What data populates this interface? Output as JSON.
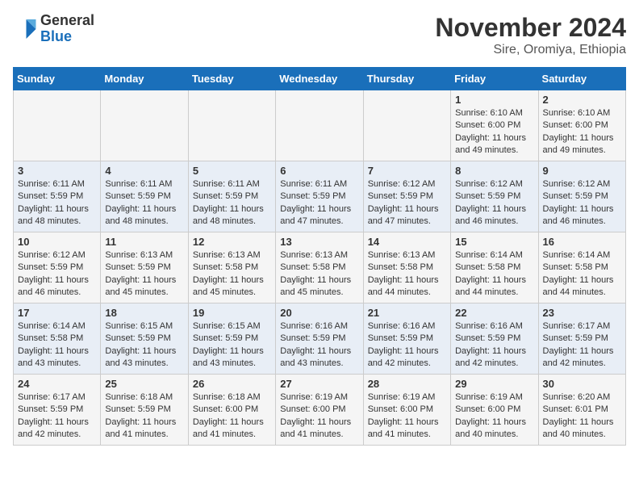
{
  "logo": {
    "general": "General",
    "blue": "Blue"
  },
  "header": {
    "month": "November 2024",
    "location": "Sire, Oromiya, Ethiopia"
  },
  "weekdays": [
    "Sunday",
    "Monday",
    "Tuesday",
    "Wednesday",
    "Thursday",
    "Friday",
    "Saturday"
  ],
  "weeks": [
    [
      {
        "day": "",
        "info": ""
      },
      {
        "day": "",
        "info": ""
      },
      {
        "day": "",
        "info": ""
      },
      {
        "day": "",
        "info": ""
      },
      {
        "day": "",
        "info": ""
      },
      {
        "day": "1",
        "info": "Sunrise: 6:10 AM\nSunset: 6:00 PM\nDaylight: 11 hours\nand 49 minutes."
      },
      {
        "day": "2",
        "info": "Sunrise: 6:10 AM\nSunset: 6:00 PM\nDaylight: 11 hours\nand 49 minutes."
      }
    ],
    [
      {
        "day": "3",
        "info": "Sunrise: 6:11 AM\nSunset: 5:59 PM\nDaylight: 11 hours\nand 48 minutes."
      },
      {
        "day": "4",
        "info": "Sunrise: 6:11 AM\nSunset: 5:59 PM\nDaylight: 11 hours\nand 48 minutes."
      },
      {
        "day": "5",
        "info": "Sunrise: 6:11 AM\nSunset: 5:59 PM\nDaylight: 11 hours\nand 48 minutes."
      },
      {
        "day": "6",
        "info": "Sunrise: 6:11 AM\nSunset: 5:59 PM\nDaylight: 11 hours\nand 47 minutes."
      },
      {
        "day": "7",
        "info": "Sunrise: 6:12 AM\nSunset: 5:59 PM\nDaylight: 11 hours\nand 47 minutes."
      },
      {
        "day": "8",
        "info": "Sunrise: 6:12 AM\nSunset: 5:59 PM\nDaylight: 11 hours\nand 46 minutes."
      },
      {
        "day": "9",
        "info": "Sunrise: 6:12 AM\nSunset: 5:59 PM\nDaylight: 11 hours\nand 46 minutes."
      }
    ],
    [
      {
        "day": "10",
        "info": "Sunrise: 6:12 AM\nSunset: 5:59 PM\nDaylight: 11 hours\nand 46 minutes."
      },
      {
        "day": "11",
        "info": "Sunrise: 6:13 AM\nSunset: 5:59 PM\nDaylight: 11 hours\nand 45 minutes."
      },
      {
        "day": "12",
        "info": "Sunrise: 6:13 AM\nSunset: 5:58 PM\nDaylight: 11 hours\nand 45 minutes."
      },
      {
        "day": "13",
        "info": "Sunrise: 6:13 AM\nSunset: 5:58 PM\nDaylight: 11 hours\nand 45 minutes."
      },
      {
        "day": "14",
        "info": "Sunrise: 6:13 AM\nSunset: 5:58 PM\nDaylight: 11 hours\nand 44 minutes."
      },
      {
        "day": "15",
        "info": "Sunrise: 6:14 AM\nSunset: 5:58 PM\nDaylight: 11 hours\nand 44 minutes."
      },
      {
        "day": "16",
        "info": "Sunrise: 6:14 AM\nSunset: 5:58 PM\nDaylight: 11 hours\nand 44 minutes."
      }
    ],
    [
      {
        "day": "17",
        "info": "Sunrise: 6:14 AM\nSunset: 5:58 PM\nDaylight: 11 hours\nand 43 minutes."
      },
      {
        "day": "18",
        "info": "Sunrise: 6:15 AM\nSunset: 5:59 PM\nDaylight: 11 hours\nand 43 minutes."
      },
      {
        "day": "19",
        "info": "Sunrise: 6:15 AM\nSunset: 5:59 PM\nDaylight: 11 hours\nand 43 minutes."
      },
      {
        "day": "20",
        "info": "Sunrise: 6:16 AM\nSunset: 5:59 PM\nDaylight: 11 hours\nand 43 minutes."
      },
      {
        "day": "21",
        "info": "Sunrise: 6:16 AM\nSunset: 5:59 PM\nDaylight: 11 hours\nand 42 minutes."
      },
      {
        "day": "22",
        "info": "Sunrise: 6:16 AM\nSunset: 5:59 PM\nDaylight: 11 hours\nand 42 minutes."
      },
      {
        "day": "23",
        "info": "Sunrise: 6:17 AM\nSunset: 5:59 PM\nDaylight: 11 hours\nand 42 minutes."
      }
    ],
    [
      {
        "day": "24",
        "info": "Sunrise: 6:17 AM\nSunset: 5:59 PM\nDaylight: 11 hours\nand 42 minutes."
      },
      {
        "day": "25",
        "info": "Sunrise: 6:18 AM\nSunset: 5:59 PM\nDaylight: 11 hours\nand 41 minutes."
      },
      {
        "day": "26",
        "info": "Sunrise: 6:18 AM\nSunset: 6:00 PM\nDaylight: 11 hours\nand 41 minutes."
      },
      {
        "day": "27",
        "info": "Sunrise: 6:19 AM\nSunset: 6:00 PM\nDaylight: 11 hours\nand 41 minutes."
      },
      {
        "day": "28",
        "info": "Sunrise: 6:19 AM\nSunset: 6:00 PM\nDaylight: 11 hours\nand 41 minutes."
      },
      {
        "day": "29",
        "info": "Sunrise: 6:19 AM\nSunset: 6:00 PM\nDaylight: 11 hours\nand 40 minutes."
      },
      {
        "day": "30",
        "info": "Sunrise: 6:20 AM\nSunset: 6:01 PM\nDaylight: 11 hours\nand 40 minutes."
      }
    ]
  ]
}
